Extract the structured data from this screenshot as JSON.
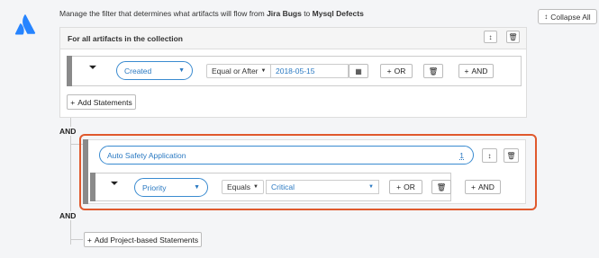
{
  "header": {
    "text_prefix": "Manage the filter that determines what artifacts will flow from ",
    "source": "Jira Bugs",
    "text_mid": " to ",
    "target": "Mysql Defects"
  },
  "collapse_all": {
    "label": "Collapse All",
    "icon": "up-down-arrows-icon"
  },
  "collection_panel": {
    "title": "For all artifacts in the collection",
    "statement": {
      "field": "Created",
      "operator": "Equal or After",
      "value": "2018-05-15",
      "or_label": "OR",
      "and_label": "AND"
    },
    "add_statements_label": "Add Statements"
  },
  "connectors": {
    "and_1": "AND",
    "and_2": "AND"
  },
  "project_group": {
    "project": "Auto Safety Application",
    "badge": "1",
    "statement": {
      "field": "Priority",
      "operator": "Equals",
      "value": "Critical",
      "or_label": "OR",
      "and_label": "AND"
    }
  },
  "add_project_statements_label": "Add Project-based Statements",
  "colors": {
    "accent": "#2a79c2",
    "highlight": "#e0592d",
    "logo": "#2684ff"
  }
}
